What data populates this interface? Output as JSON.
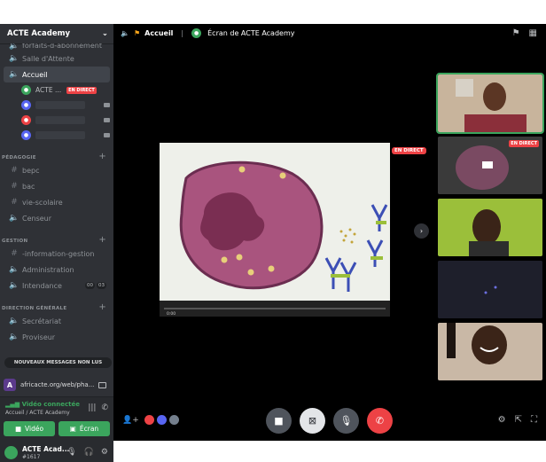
{
  "server": {
    "name": "ACTE Academy"
  },
  "channels": {
    "top": [
      {
        "name": "forfaits-d-abonnement",
        "icon": "speaker-icon"
      },
      {
        "name": "Salle d'Attente",
        "icon": "speaker-icon"
      },
      {
        "name": "Accueil",
        "icon": "speaker-icon",
        "active": true
      }
    ],
    "voice_users": [
      {
        "name": "ACTE ...",
        "live": "EN DIRECT"
      }
    ],
    "categories": [
      {
        "name": "PÉDAGOGIE",
        "channels": [
          "bepc",
          "bac",
          "vie-scolaire",
          "Censeur"
        ]
      },
      {
        "name": "GESTION",
        "channels": [
          "-information-gestion",
          "Administration",
          "Intendance"
        ]
      },
      {
        "name": "DIRECTION GÉNÉRALE",
        "channels": [
          "Secrétariat",
          "Proviseur"
        ]
      }
    ],
    "intendance_counts": [
      "00",
      "03"
    ]
  },
  "new_messages": "NOUVEAUX MESSAGES NON LUS",
  "activity_url": "africacte.org/web/pha...",
  "voice_panel": {
    "status": "Vidéo connectée",
    "location": "Accueil / ACTE Academy",
    "video_label": "Vidéo",
    "screen_label": "Écran"
  },
  "user": {
    "name": "ACTE Acad...",
    "tag": "#1617"
  },
  "topbar": {
    "channel": "Accueil",
    "stream_title": "Écran de ACTE Academy"
  },
  "stage": {
    "live_label": "EN DIRECT",
    "video_time": "0:00"
  },
  "thumb_live": "EN DIRECT",
  "colors": {
    "accent_green": "#3ba55d",
    "live_red": "#ed4245",
    "sidebar": "#2f3136"
  }
}
